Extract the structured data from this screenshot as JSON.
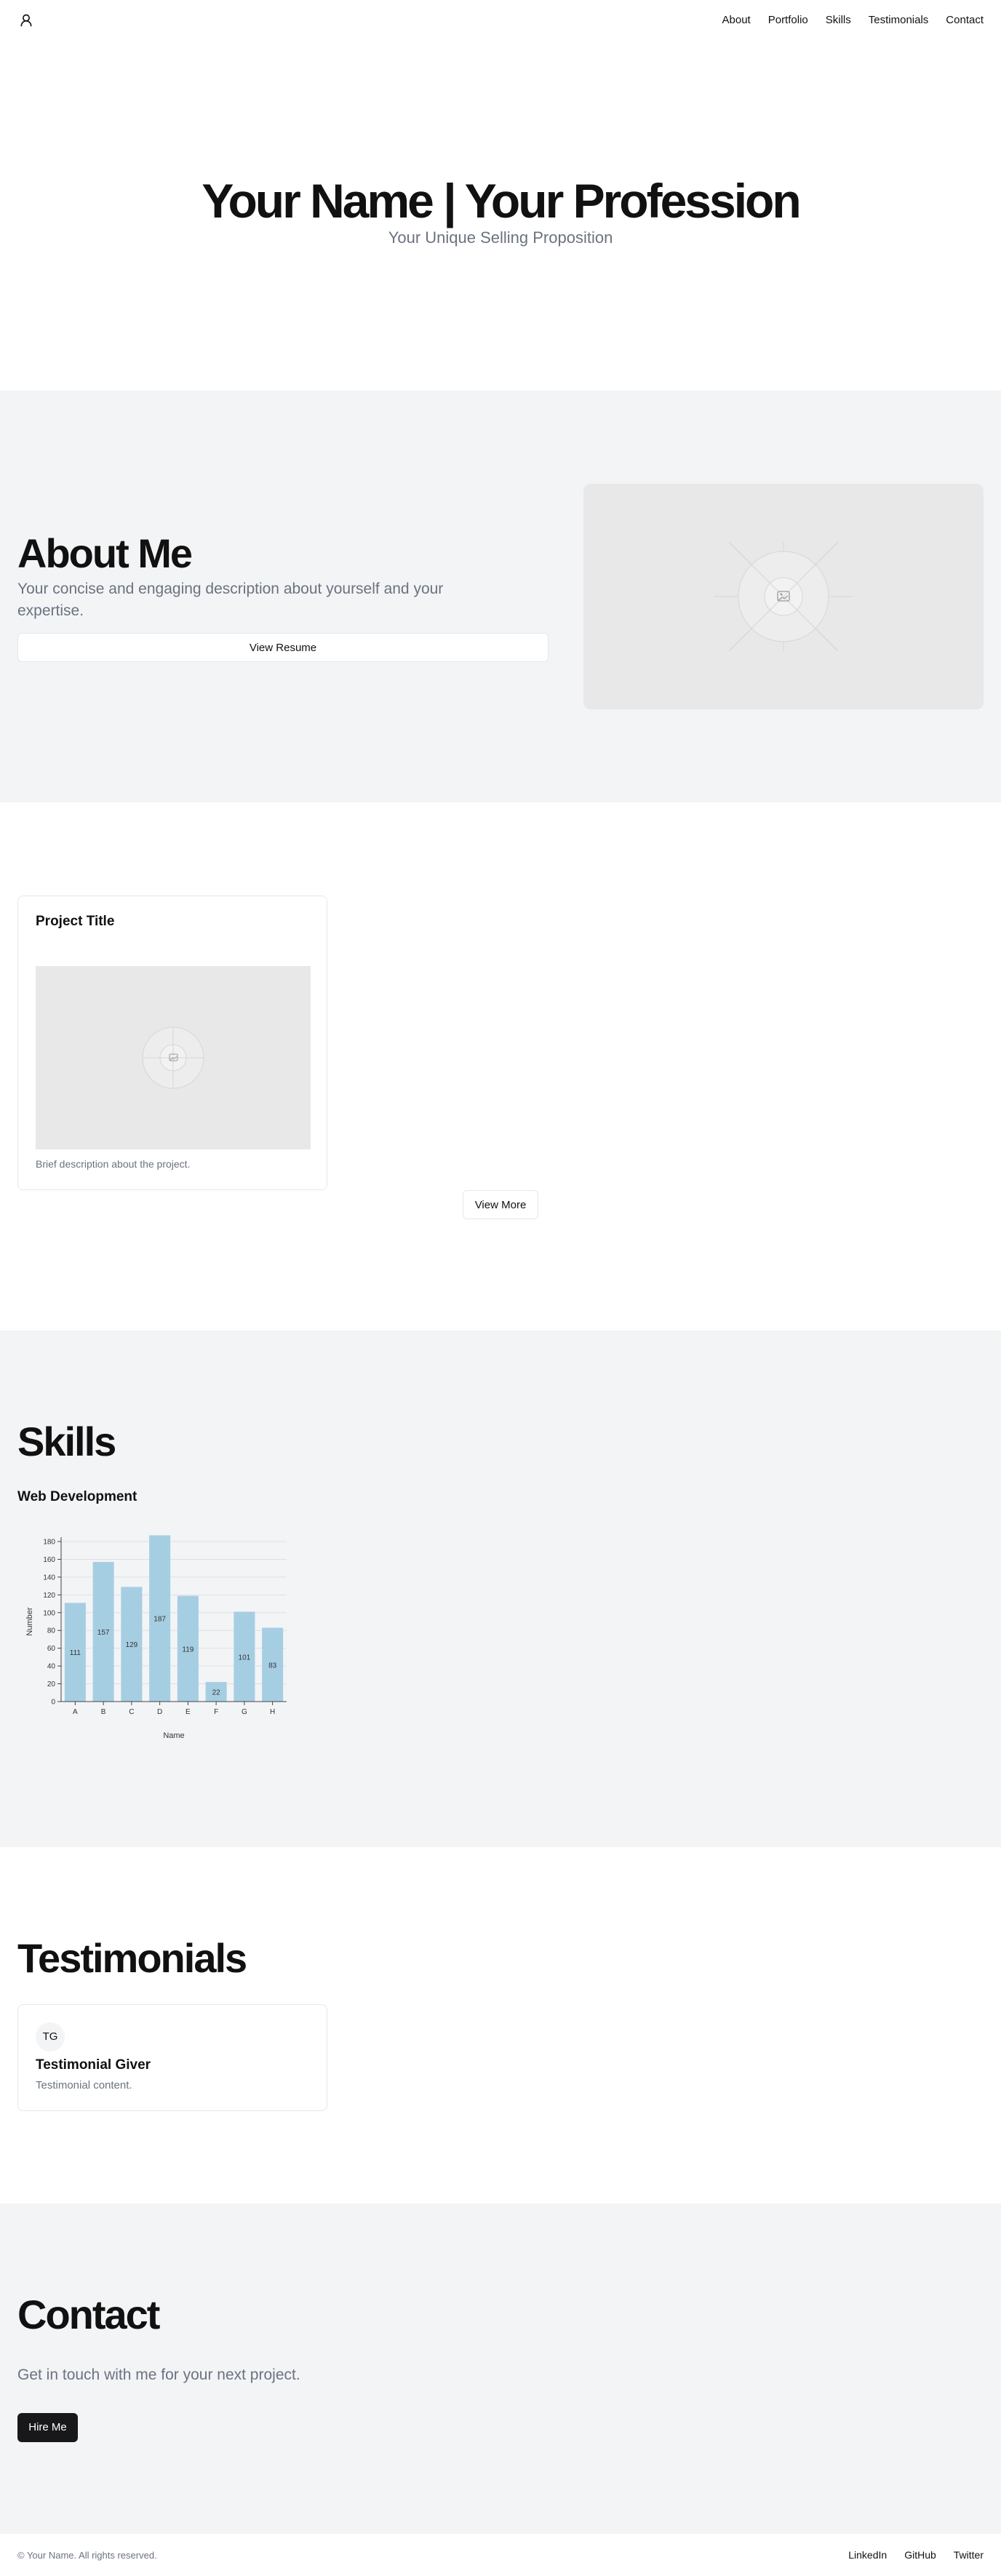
{
  "header": {
    "logo_icon": "user-icon",
    "nav": [
      "About",
      "Portfolio",
      "Skills",
      "Testimonials",
      "Contact"
    ]
  },
  "hero": {
    "title": "Your Name | Your Profession",
    "subtitle": "Your Unique Selling Proposition"
  },
  "about": {
    "title": "About Me",
    "description": "Your concise and engaging description about yourself and your expertise.",
    "button": "View Resume",
    "image_icon": "image-placeholder-icon"
  },
  "portfolio": {
    "project_title": "Project Title",
    "project_description": "Brief description about the project.",
    "view_more": "View More"
  },
  "skills": {
    "title": "Skills",
    "category": "Web Development"
  },
  "chart_data": {
    "type": "bar",
    "categories": [
      "A",
      "B",
      "C",
      "D",
      "E",
      "F",
      "G",
      "H"
    ],
    "values": [
      111,
      157,
      129,
      187,
      119,
      22,
      101,
      83
    ],
    "xlabel": "Name",
    "ylabel": "Number",
    "ylim": [
      0,
      180
    ],
    "yticks": [
      0,
      20,
      40,
      60,
      80,
      100,
      120,
      140,
      160,
      180
    ],
    "grid": true,
    "bar_color": "#a6cee3"
  },
  "testimonials": {
    "title": "Testimonials",
    "initials": "TG",
    "giver": "Testimonial Giver",
    "content": "Testimonial content."
  },
  "contact": {
    "title": "Contact",
    "text": "Get in touch with me for your next project.",
    "button": "Hire Me"
  },
  "footer": {
    "copyright": "© Your Name. All rights reserved.",
    "links": [
      "LinkedIn",
      "GitHub",
      "Twitter"
    ]
  }
}
